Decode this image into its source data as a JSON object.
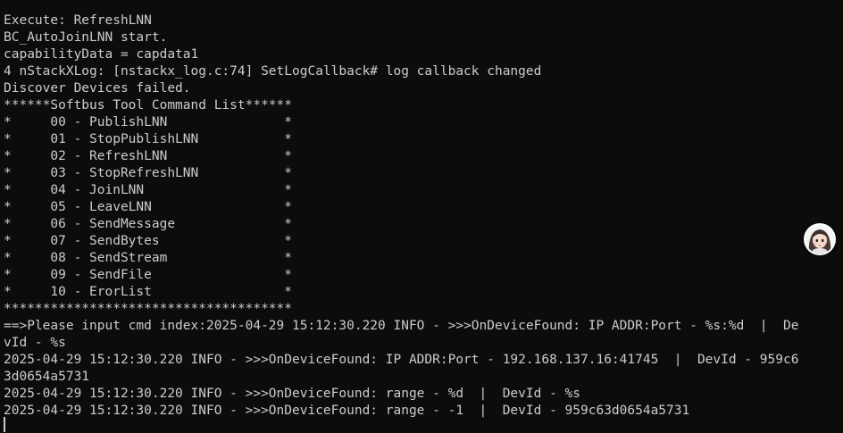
{
  "terminal": {
    "colors": {
      "background": "#0c0c0c",
      "text": "#cccccc"
    },
    "lines": [
      "Execute: RefreshLNN",
      "BC_AutoJoinLNN start.",
      "capabilityData = capdata1",
      "4 nStackXLog: [nstackx_log.c:74] SetLogCallback# log callback changed",
      "Discover Devices failed.",
      "******Softbus Tool Command List******",
      "*     00 - PublishLNN               *",
      "*     01 - StopPublishLNN           *",
      "*     02 - RefreshLNN               *",
      "*     03 - StopRefreshLNN           *",
      "*     04 - JoinLNN                  *",
      "*     05 - LeaveLNN                 *",
      "*     06 - SendMessage              *",
      "*     07 - SendBytes                *",
      "*     08 - SendStream               *",
      "*     09 - SendFile                 *",
      "*     10 - ErorList                 *",
      "*************************************",
      "==>Please input cmd index:2025-04-29 15:12:30.220 INFO - >>>OnDeviceFound: IP ADDR:Port - %s:%d  |  De",
      "vId - %s",
      "2025-04-29 15:12:30.220 INFO - >>>OnDeviceFound: IP ADDR:Port - 192.168.137.16:41745  |  DevId - 959c6",
      "3d0654a5731",
      "2025-04-29 15:12:30.220 INFO - >>>OnDeviceFound: range - %d  |  DevId - %s",
      "2025-04-29 15:12:30.220 INFO - >>>OnDeviceFound: range - -1  |  DevId - 959c63d0654a5731"
    ]
  },
  "overlay": {
    "avatar_icon": "user-avatar-icon"
  }
}
